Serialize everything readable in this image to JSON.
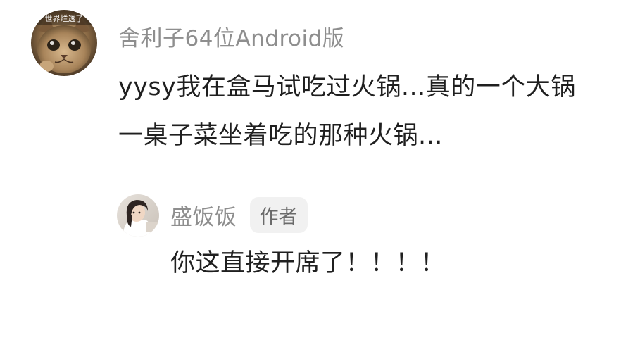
{
  "comments": [
    {
      "username": "舍利子64位Android版",
      "avatar_text": "世界烂透了",
      "text_lines": [
        "yysy我在盒马试吃过火锅...真的一个大锅",
        "一桌子菜坐着吃的那种火锅..."
      ]
    },
    {
      "username": "盛饭饭",
      "badge": "作者",
      "text_lines": [
        "你这直接开席了！！！！"
      ]
    }
  ]
}
